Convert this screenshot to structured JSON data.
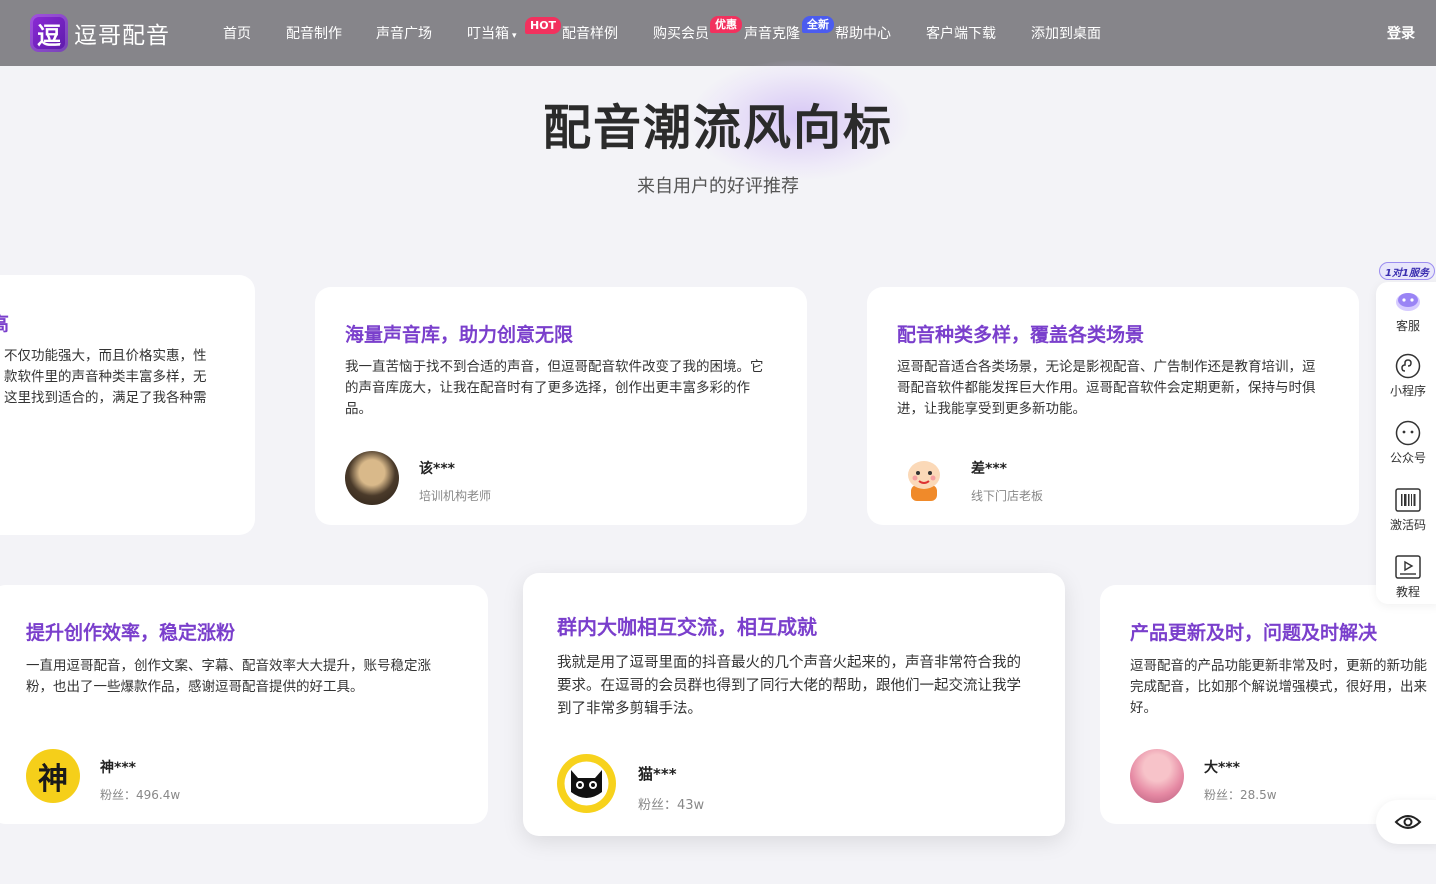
{
  "header": {
    "brand": "逗哥配音",
    "logo_glyph": "逗",
    "nav": [
      {
        "label": "首页"
      },
      {
        "label": "配音制作"
      },
      {
        "label": "声音广场"
      },
      {
        "label": "叮当箱",
        "caret": "▾"
      },
      {
        "label": "配音样例"
      },
      {
        "label": "购买会员"
      },
      {
        "label": "声音克隆"
      },
      {
        "label": "帮助中心"
      },
      {
        "label": "客户端下载"
      },
      {
        "label": "添加到桌面"
      }
    ],
    "badges": {
      "hot": "HOT",
      "sale": "优惠",
      "new": "全新"
    },
    "login": "登录",
    "colors": {
      "header_bg": "#86858a",
      "hot": "#f2315e",
      "new": "#4b5cf0"
    }
  },
  "hero": {
    "title": "配音潮流风向标",
    "subtitle": "来自用户的好评推荐"
  },
  "testimonials": [
    {
      "title": "高",
      "body": "不仅功能强大，而且价格实惠，性款软件里的声音种类丰富多样，无这里找到适合的，满足了我各种需",
      "lines": [
        "不仅功能强大，而且价格实惠，性",
        "款软件里的声音种类丰富多样，无",
        "这里找到适合的，满足了我各种需"
      ]
    },
    {
      "title": "海量声音库，助力创意无限",
      "body": "我一直苦恼于找不到合适的声音，但逗哥配音软件改变了我的困境。它的声音库庞大，让我在配音时有了更多选择，创作出更丰富多彩的作品。",
      "user": "该***",
      "role": "培训机构老师"
    },
    {
      "title": "配音种类多样，覆盖各类场景",
      "body": "逗哥配音适合各类场景，无论是影视配音、广告制作还是教育培训，逗哥配音软件都能发挥巨大作用。逗哥配音软件会定期更新，保持与时俱进，让我能享受到更多新功能。",
      "user": "差***",
      "role": "线下门店老板"
    },
    {
      "title": "提升创作效率，稳定涨粉",
      "body": "一直用逗哥配音，创作文案、字幕、配音效率大大提升，账号稳定涨粉，也出了一些爆款作品，感谢逗哥配音提供的好工具。",
      "user": "神***",
      "role": "粉丝：496.4w",
      "avatar_glyph": "神"
    },
    {
      "title": "群内大咖相互交流，相互成就",
      "body": "我就是用了逗哥里面的抖音最火的几个声音火起来的，声音非常符合我的要求。在逗哥的会员群也得到了同行大佬的帮助，跟他们一起交流让我学到了非常多剪辑手法。",
      "user": "猫***",
      "role": "粉丝：43w"
    },
    {
      "title": "产品更新及时，问题及时解决",
      "body": "逗哥配音的产品功能更新非常及时，更新的新功能完成配音，比如那个解说增强模式，很好用，出来好。",
      "lines": [
        "逗哥配音的产品功能更新非常及时，更新的新功能",
        "完成配音，比如那个解说增强模式，很好用，出来",
        "好。"
      ],
      "user": "大***",
      "role": "粉丝：28.5w"
    }
  ],
  "sidebar": {
    "badge": "1对1服务",
    "items": [
      {
        "label": "客服",
        "icon": "customer-service-icon"
      },
      {
        "label": "小程序",
        "icon": "mini-program-icon"
      },
      {
        "label": "公众号",
        "icon": "wechat-icon"
      },
      {
        "label": "激活码",
        "icon": "barcode-icon"
      },
      {
        "label": "教程",
        "icon": "video-tutorial-icon"
      }
    ],
    "eye_icon": "eye-icon"
  },
  "accent": "#7a3fcc"
}
